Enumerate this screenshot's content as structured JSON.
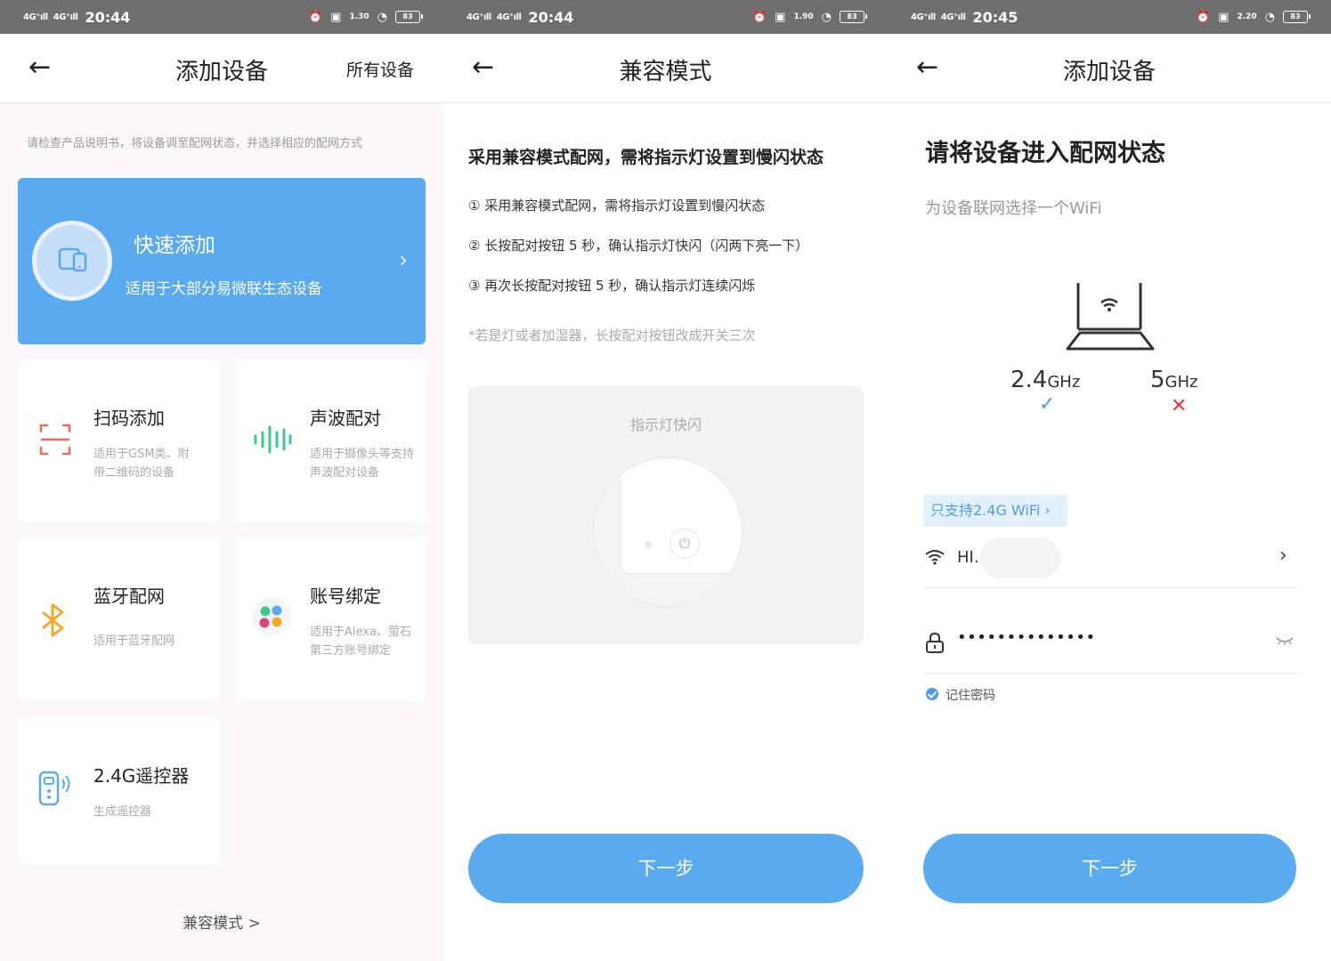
{
  "colors": {
    "accent": "#5aaaf0",
    "status_bar": "#6f6f6f",
    "error": "#e53935"
  },
  "status_bars": [
    {
      "signal1": "4G⁺ıll",
      "signal2": "4G⁺ıll",
      "time": "20:44",
      "speed": "1.30",
      "battery": "83"
    },
    {
      "signal1": "4G⁺ıll",
      "signal2": "4G⁺ıll",
      "time": "20:44",
      "speed": "1.90",
      "battery": "83"
    },
    {
      "signal1": "4G⁺ıll",
      "signal2": "4G⁺ıll",
      "time": "20:45",
      "speed": "2.20",
      "battery": "83"
    }
  ],
  "screen1": {
    "title": "添加设备",
    "right_action": "所有设备",
    "hint": "请检查产品说明书，将设备调至配网状态，并选择相应的配网方式",
    "quick_add": {
      "title": "快速添加",
      "subtitle": "适用于大部分易微联生态设备",
      "icon": "device-phone-icon"
    },
    "tiles": [
      {
        "title": "扫码添加",
        "sub1": "适用于GSM类、附",
        "sub2": "带二维码的设备",
        "icon": "scan-icon"
      },
      {
        "title": "声波配对",
        "sub1": "适用于摄像头等支持",
        "sub2": "声波配对设备",
        "icon": "soundwave-icon"
      },
      {
        "title": "蓝牙配网",
        "sub1": "适用于蓝牙配网",
        "sub2": "",
        "icon": "bluetooth-icon"
      },
      {
        "title": "账号绑定",
        "sub1": "适用于Alexa、萤石",
        "sub2": "第三方账号绑定",
        "icon": "account-icon"
      },
      {
        "title": "2.4G遥控器",
        "sub1": "生成遥控器",
        "sub2": "",
        "icon": "remote-icon"
      }
    ],
    "compat_link": "兼容模式 >"
  },
  "screen2": {
    "title": "兼容模式",
    "heading": "采用兼容模式配网，需将指示灯设置到慢闪状态",
    "steps": [
      "① 采用兼容模式配网，需将指示灯设置到慢闪状态",
      "② 长按配对按钮 5 秒，确认指示灯快闪（闪两下亮一下）",
      "③ 再次长按配对按钮 5 秒，确认指示灯连续闪烁"
    ],
    "note": "*若是灯或者加湿器，长按配对按钮改成开关三次",
    "panel_label": "指示灯快闪",
    "next_label": "下一步"
  },
  "screen3": {
    "title": "添加设备",
    "heading": "请将设备进入配网状态",
    "subheading": "为设备联网选择一个WiFi",
    "band_24": "2.4",
    "band_5": "5",
    "band_unit": "GHz",
    "wifi_tag": "只支持2.4G WiFi ›",
    "wifi_name": "HI.",
    "password_mask": "••••••••••••••",
    "remember_label": "记住密码",
    "next_label": "下一步"
  }
}
